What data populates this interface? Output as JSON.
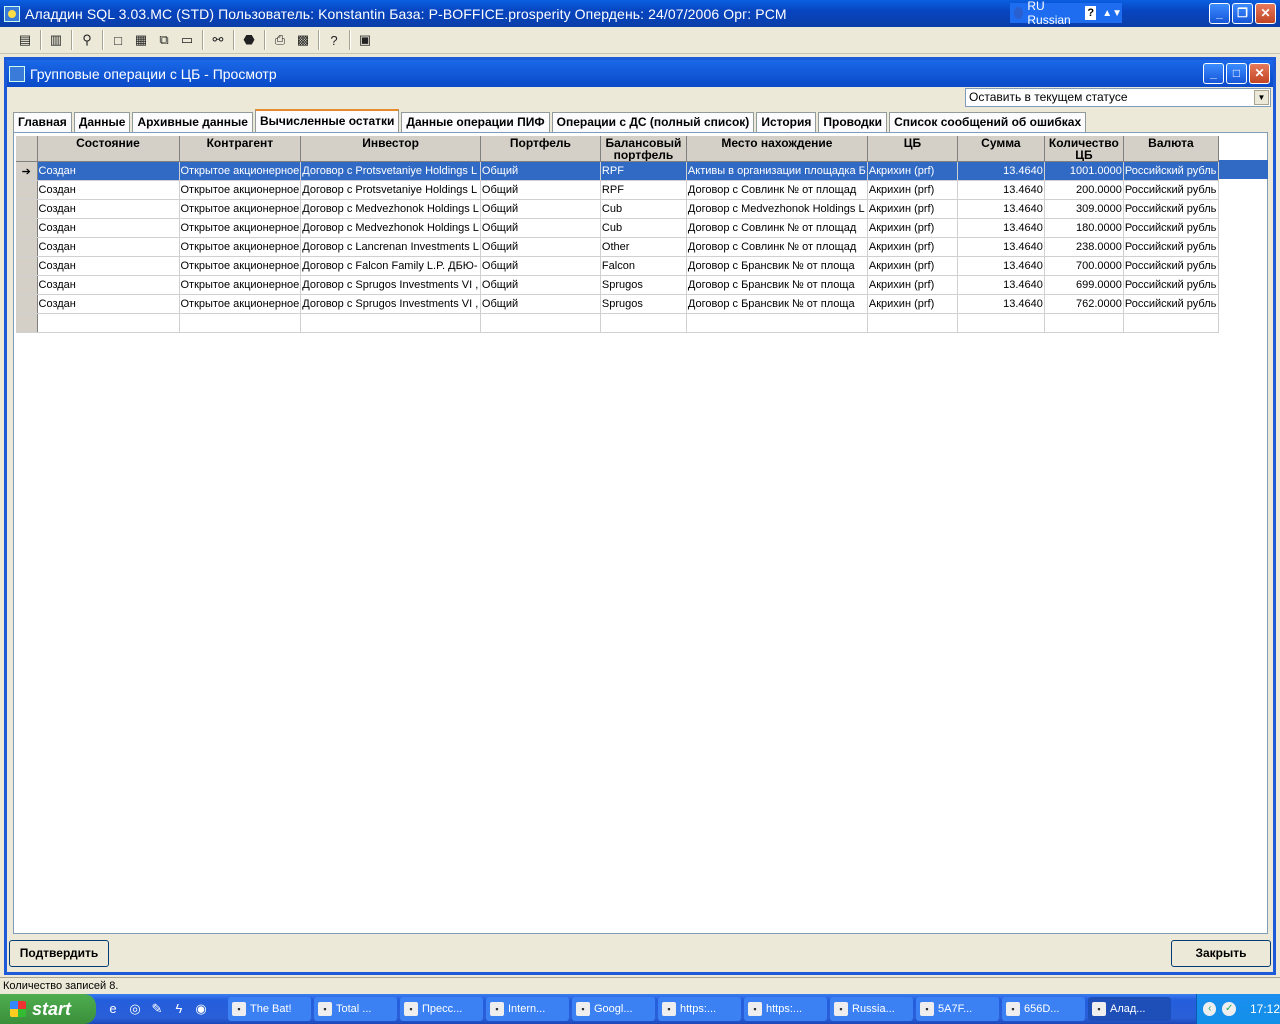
{
  "window": {
    "title": "Аладдин SQL 3.03.MC (STD)  Пользователь: Konstantin База: P-BOFFICE.prosperity Опердень: 24/07/2006 Орг: PCM",
    "language": "RU Russian"
  },
  "child": {
    "title": "Групповые операции с ЦБ - Просмотр",
    "status_select": "Оставить в текущем статусе",
    "tabs": [
      "Главная",
      "Данные",
      "Архивные данные",
      "Вычисленные остатки",
      "Данные операции ПИФ",
      "Операции с ДС (полный список)",
      "История",
      "Проводки",
      "Список сообщений об ошибках"
    ],
    "active_tab": 3,
    "columns": [
      "Состояние",
      "Контрагент",
      "Инвестор",
      "Портфель",
      "Балансовый портфель",
      "Место нахождение",
      "ЦБ",
      "Сумма",
      "Количество ЦБ",
      "Валюта"
    ],
    "rows": [
      [
        "Создан",
        "Открытое акционерное",
        "Договор с Protsvetaniye Holdings L",
        "Общий",
        "RPF",
        "Активы в организации площадка Б",
        "Акрихин (prf)",
        "13.4640",
        "1001.0000",
        "Российский рубль"
      ],
      [
        "Создан",
        "Открытое акционерное",
        "Договор с Protsvetaniye Holdings L",
        "Общий",
        "RPF",
        "Договор с Совлинк №  от  площад",
        "Акрихин (prf)",
        "13.4640",
        "200.0000",
        "Российский рубль"
      ],
      [
        "Создан",
        "Открытое акционерное",
        "Договор с Medvezhonok Holdings L",
        "Общий",
        "Cub",
        "Договор с Medvezhonok Holdings L",
        "Акрихин (prf)",
        "13.4640",
        "309.0000",
        "Российский рубль"
      ],
      [
        "Создан",
        "Открытое акционерное",
        "Договор с Medvezhonok Holdings L",
        "Общий",
        "Cub",
        "Договор с Совлинк №  от  площад",
        "Акрихин (prf)",
        "13.4640",
        "180.0000",
        "Российский рубль"
      ],
      [
        "Создан",
        "Открытое акционерное",
        "Договор с Lancrenan Investments L",
        "Общий",
        "Other",
        "Договор с Совлинк №  от  площад",
        "Акрихин (prf)",
        "13.4640",
        "238.0000",
        "Российский рубль"
      ],
      [
        "Создан",
        "Открытое акционерное",
        "Договор с Falcon Family L.P. ДБЮ-",
        "Общий",
        "Falcon",
        "Договор с Брансвик №  от  площа",
        "Акрихин (prf)",
        "13.4640",
        "700.0000",
        "Российский рубль"
      ],
      [
        "Создан",
        "Открытое акционерное",
        "Договор с Sprugos Investments VI ,",
        "Общий",
        "Sprugos",
        "Договор с Брансвик №  от  площа",
        "Акрихин (prf)",
        "13.4640",
        "699.0000",
        "Российский рубль"
      ],
      [
        "Создан",
        "Открытое акционерное",
        "Договор с Sprugos Investments VI ,",
        "Общий",
        "Sprugos",
        "Договор с Брансвик №  от  площа",
        "Акрихин (prf)",
        "13.4640",
        "762.0000",
        "Российский рубль"
      ]
    ],
    "confirm_label": "Подтвердить",
    "close_label": "Закрыть"
  },
  "statusbar": {
    "text": "Количество записей 8."
  },
  "taskbar": {
    "start_label": "start",
    "tasks": [
      "The Bat!",
      "Total ...",
      "Пресс...",
      "Intern...",
      "Googl...",
      "https:...",
      "https:...",
      "Russia...",
      "5A7F...",
      "656D...",
      "Алад..."
    ],
    "clock": "17:12"
  },
  "colors": {
    "title_blue": "#0a4ac8",
    "selection": "#316ac5",
    "tab_active_border": "#e68b2c"
  }
}
